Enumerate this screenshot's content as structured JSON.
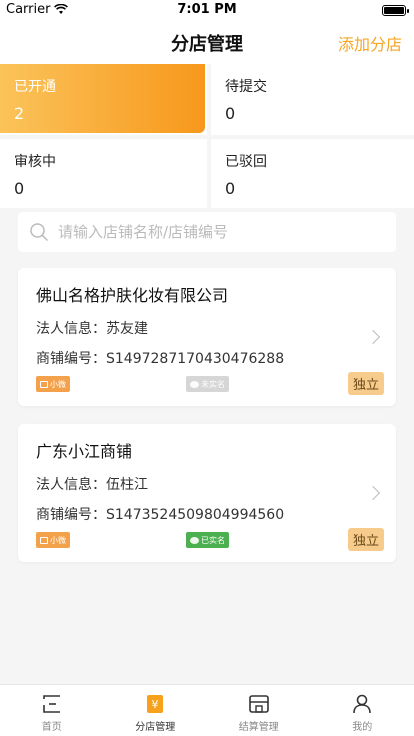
{
  "status_bar": {
    "carrier": "Carrier",
    "time": "7:01 PM"
  },
  "nav": {
    "title": "分店管理",
    "action": "添加分店"
  },
  "stats": [
    {
      "label": "已开通",
      "count": "2",
      "active": true
    },
    {
      "label": "待提交",
      "count": "0",
      "active": false
    },
    {
      "label": "审核中",
      "count": "0",
      "active": false
    },
    {
      "label": "已驳回",
      "count": "0",
      "active": false
    }
  ],
  "search": {
    "placeholder": "请输入店铺名称/店铺编号"
  },
  "stores": [
    {
      "name": "佛山名格护肤化妆有限公司",
      "legal_label": "法人信息：",
      "legal_value": "苏友建",
      "id_label": "商铺编号：",
      "id_value": "S1497287170430476288",
      "type_tag": "小微",
      "verify_tag": "未实名",
      "verified": false,
      "badge": "独立"
    },
    {
      "name": "广东小江商铺",
      "legal_label": "法人信息：",
      "legal_value": "伍柱江",
      "id_label": "商铺编号：",
      "id_value": "S1473524509804994560",
      "type_tag": "小微",
      "verify_tag": "已实名",
      "verified": true,
      "badge": "独立"
    }
  ],
  "tabs": [
    {
      "label": "首页",
      "icon": "home-icon",
      "active": false
    },
    {
      "label": "分店管理",
      "icon": "branch-store-icon",
      "active": true
    },
    {
      "label": "结算管理",
      "icon": "settlement-store-icon",
      "active": false
    },
    {
      "label": "我的",
      "icon": "profile-icon",
      "active": false
    }
  ],
  "colors": {
    "accent": "#f7981c",
    "accent_light": "#fbc35a",
    "action_text": "#f5a623",
    "verified_green": "#4caf50",
    "badge_bg": "#f7cb8b"
  }
}
